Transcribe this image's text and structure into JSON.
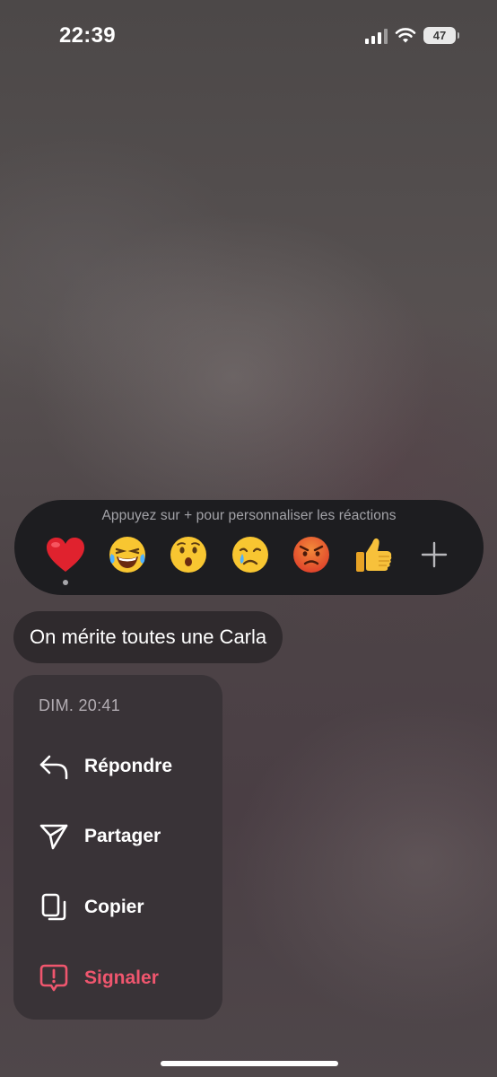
{
  "status_bar": {
    "time": "22:39",
    "battery": "47",
    "signal_icon": "signal-bars-icon",
    "wifi_icon": "wifi-icon"
  },
  "reactions": {
    "hint": "Appuyez sur + pour personnaliser les réactions",
    "items": [
      {
        "name": "heart",
        "selected": true
      },
      {
        "name": "joy"
      },
      {
        "name": "astonished"
      },
      {
        "name": "crying"
      },
      {
        "name": "angry"
      },
      {
        "name": "thumbs-up"
      }
    ],
    "add_icon": "plus-icon"
  },
  "message": {
    "text": "On mérite toutes une Carla"
  },
  "menu": {
    "timestamp": "DIM. 20:41",
    "items": [
      {
        "label": "Répondre",
        "icon": "reply-icon"
      },
      {
        "label": "Partager",
        "icon": "share-icon"
      },
      {
        "label": "Copier",
        "icon": "copy-icon"
      },
      {
        "label": "Signaler",
        "icon": "report-icon",
        "color": "#f0566e"
      }
    ]
  },
  "colors": {
    "reaction_bar": "#1d1d20",
    "bubble": "#2f2a2d",
    "menu": "#373236",
    "danger": "#f0566e"
  }
}
